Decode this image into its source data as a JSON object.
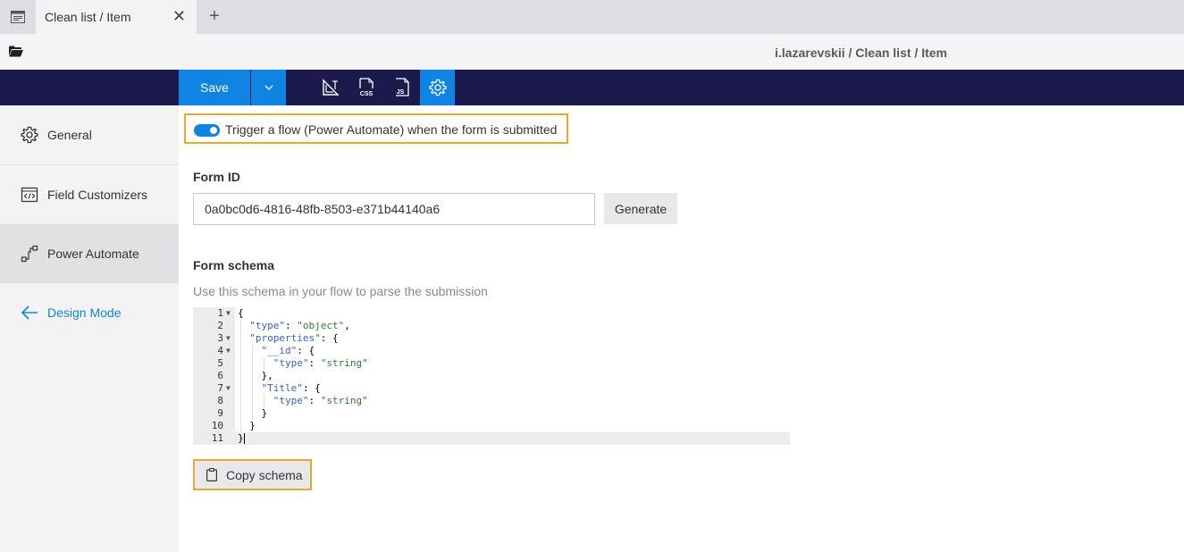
{
  "tabs": {
    "active": {
      "title": "Clean list / Item",
      "close": "✕"
    },
    "new_tab": "+"
  },
  "pathbar": {
    "breadcrumb": "i.lazarevskii / Clean list / Item"
  },
  "toolbar": {
    "save_label": "Save",
    "icons": [
      "layout-icon",
      "css-icon",
      "js-icon",
      "settings-icon"
    ],
    "active_icon": "settings-icon"
  },
  "sidebar": {
    "items": [
      {
        "label": "General",
        "icon": "gear-icon"
      },
      {
        "label": "Field Customizers",
        "icon": "code-window-icon"
      },
      {
        "label": "Power Automate",
        "icon": "flow-icon",
        "active": true
      },
      {
        "label": "Design Mode",
        "icon": "arrow-left-icon"
      }
    ]
  },
  "main": {
    "trigger": {
      "label": "Trigger a flow (Power Automate) when the form is submitted",
      "enabled": true
    },
    "form_id": {
      "label": "Form ID",
      "value": "0a0bc0d6-4816-48fb-8503-e371b44140a6",
      "generate_label": "Generate"
    },
    "schema": {
      "label": "Form schema",
      "help": "Use this schema in your flow to parse the submission",
      "line_numbers": [
        "1",
        "2",
        "3",
        "4",
        "5",
        "6",
        "7",
        "8",
        "9",
        "10",
        "11"
      ],
      "copy_label": "Copy schema"
    }
  },
  "colors": {
    "accent": "#0f84e2",
    "toolbar_bg": "#1c1a4d",
    "highlight_border": "#e8a830",
    "sidebar_bg": "#f3f3f4"
  }
}
